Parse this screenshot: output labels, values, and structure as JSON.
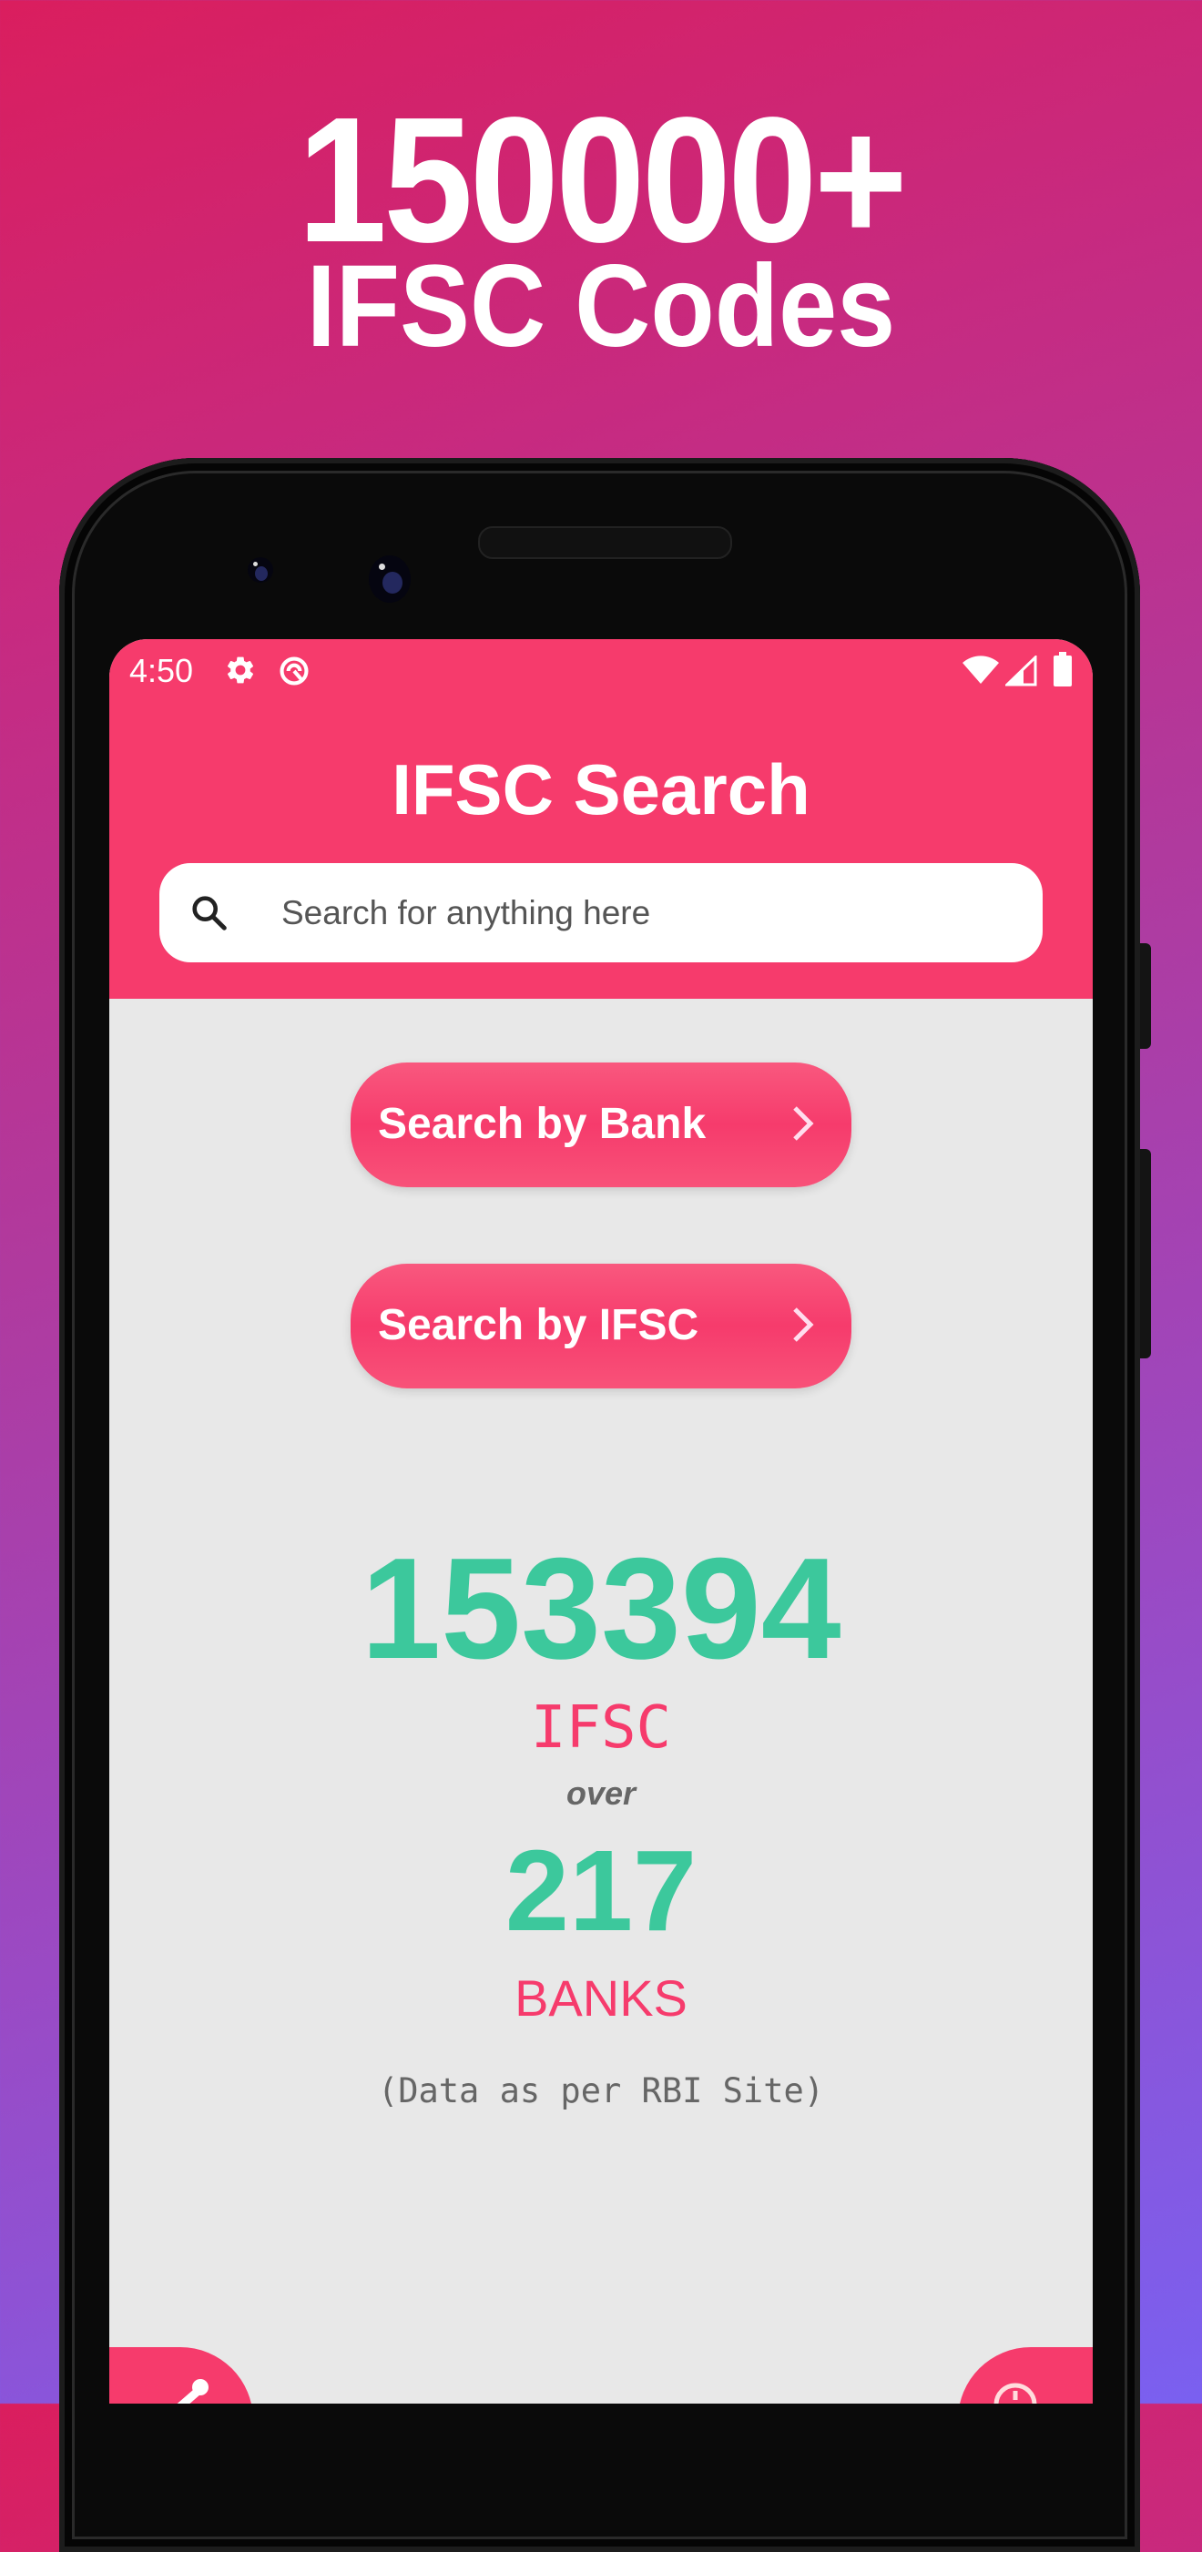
{
  "promo": {
    "headline_count": "150000+",
    "headline_label": "IFSC Codes"
  },
  "status_bar": {
    "time": "4:50",
    "left_icons": [
      "settings-icon",
      "data-saver-icon"
    ],
    "right_icons": [
      "wifi-icon",
      "cell-signal-icon",
      "battery-icon"
    ]
  },
  "app": {
    "title": "IFSC Search",
    "search": {
      "placeholder": "Search for anything here",
      "value": ""
    },
    "buttons": [
      {
        "label": "Search by Bank",
        "icon": "chevron-right-icon"
      },
      {
        "label": "Search by IFSC",
        "icon": "chevron-right-icon"
      }
    ],
    "stats": {
      "ifsc_count": "153394",
      "ifsc_label": "IFSC",
      "connector": "over",
      "bank_count": "217",
      "bank_label": "BANKS",
      "source_note": "(Data as per RBI Site)"
    },
    "fabs": {
      "left_icon": "share-icon",
      "right_icon": "info-icon"
    }
  },
  "colors": {
    "primary": "#F63B6C",
    "accent_green": "#3CC89C",
    "body_bg": "#E8E8E8",
    "text_gray": "#666666"
  }
}
